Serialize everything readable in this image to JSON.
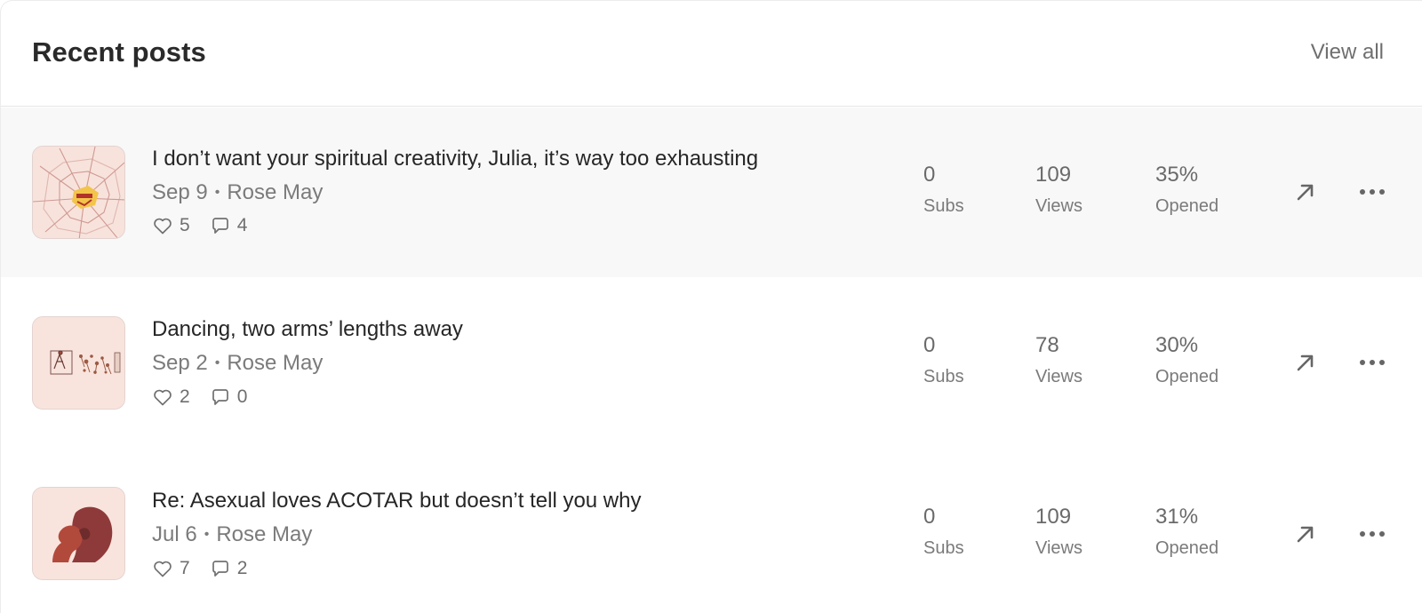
{
  "header": {
    "title": "Recent posts",
    "view_all": "View all"
  },
  "posts": [
    {
      "title": "I don’t want your spiritual creativity, Julia, it’s way too exhausting",
      "date": "Sep 9",
      "separator": "•",
      "author": "Rose May",
      "likes": "5",
      "comments": "4",
      "subs": "0",
      "subs_label": "Subs",
      "views": "109",
      "views_label": "Views",
      "opened": "35%",
      "opened_label": "Opened",
      "thumbnail_icon": "shattered-glass-image"
    },
    {
      "title": "Dancing, two arms’ lengths away",
      "date": "Sep 2",
      "separator": "•",
      "author": "Rose May",
      "likes": "2",
      "comments": "0",
      "subs": "0",
      "subs_label": "Subs",
      "views": "78",
      "views_label": "Views",
      "opened": "30%",
      "opened_label": "Opened",
      "thumbnail_icon": "dancing-figures-image"
    },
    {
      "title": "Re: Asexual loves ACOTAR but doesn’t tell you why",
      "date": "Jul 6",
      "separator": "•",
      "author": "Rose May",
      "likes": "7",
      "comments": "2",
      "subs": "0",
      "subs_label": "Subs",
      "views": "109",
      "views_label": "Views",
      "opened": "31%",
      "opened_label": "Opened",
      "thumbnail_icon": "embracing-couple-silhouette-image"
    }
  ],
  "colors": {
    "highlight_row": "#f8f8f8",
    "thumb_bg": "#f9e4dd",
    "muted_text": "#7b7b7b"
  },
  "icons": [
    "heart-icon",
    "comment-icon",
    "arrow-up-right-icon",
    "more-dots-icon"
  ]
}
